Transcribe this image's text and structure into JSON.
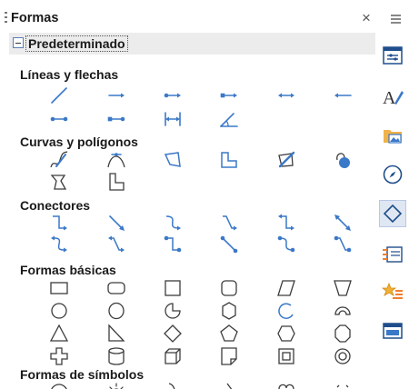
{
  "panel": {
    "title": "Formas",
    "close_glyph": "×",
    "category": "Predeterminado"
  },
  "sections": [
    {
      "key": "lines",
      "title": "Líneas y flechas"
    },
    {
      "key": "curves",
      "title": "Curvas y polígonos"
    },
    {
      "key": "connectors",
      "title": "Conectores"
    },
    {
      "key": "basic",
      "title": "Formas básicas"
    },
    {
      "key": "symbols",
      "title": "Formas de símbolos"
    }
  ],
  "shapes": {
    "lines": [
      "line-icon",
      "line-ends-with-arrow-icon",
      "line-circle-arrow-icon",
      "line-square-arrow-icon",
      "double-arrow-line-icon",
      "line-starts-with-arrow-icon",
      "line-circle-circle-icon",
      "line-square-circle-icon",
      "dimension-line-icon",
      "angle-line-icon"
    ],
    "curves": [
      "freeform-line-icon",
      "curve-icon",
      "polygon-icon",
      "polygon-45-icon",
      "freeform-filled-icon",
      "curve-filled-icon",
      "polygon-filled-icon",
      "polygon-45-filled-icon"
    ],
    "connectors": [
      "connector-icon",
      "straight-connector-icon",
      "curved-connector-icon",
      "line-connector-icon",
      "connector-ends-arrow-icon",
      "straight-connector-arrow-icon",
      "curved-connector-arrows-icon",
      "line-connector-arrows-icon",
      "connector-circles-icon",
      "straight-connector-circles-icon",
      "curved-connector-circles-icon",
      "line-connector-circles-icon"
    ],
    "basic": [
      "rectangle-icon",
      "rounded-rectangle-icon",
      "square-icon",
      "rounded-square-icon",
      "parallelogram-icon",
      "trapezoid-icon",
      "circle-icon",
      "ellipse-icon",
      "circle-pie-icon",
      "octagon-icon",
      "arc-icon",
      "block-arc-icon",
      "isosceles-triangle-icon",
      "right-triangle-icon",
      "diamond-icon",
      "pentagon-icon",
      "hexagon-icon",
      "octagon-alt-icon",
      "cross-icon",
      "can-icon",
      "cube-icon",
      "folded-corner-icon",
      "frame-icon",
      "ring-icon"
    ],
    "symbols": [
      "smiley-icon",
      "sun-icon",
      "moon-icon",
      "lightning-icon",
      "heart-icon",
      "flower-icon"
    ]
  },
  "sidebar": {
    "menu_icon": "hamburger-menu-icon",
    "items": [
      {
        "icon": "properties-icon",
        "active": false
      },
      {
        "icon": "styles-icon",
        "active": false
      },
      {
        "icon": "gallery-icon",
        "active": false
      },
      {
        "icon": "navigator-icon",
        "active": false
      },
      {
        "icon": "shapes-icon",
        "active": true
      },
      {
        "icon": "slide-transition-icon",
        "active": false
      },
      {
        "icon": "animation-icon",
        "active": false
      },
      {
        "icon": "master-slides-icon",
        "active": false
      }
    ]
  },
  "colors": {
    "accent": "#3a78c8",
    "outline": "#3c3c3c",
    "fill_blue": "#3a78c8",
    "active_bg": "#dfe7f3"
  }
}
